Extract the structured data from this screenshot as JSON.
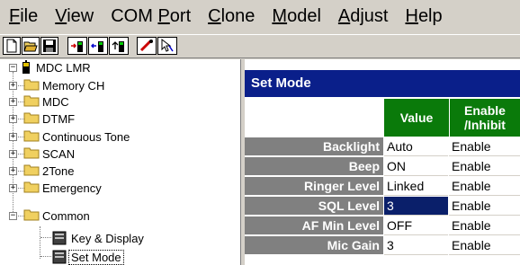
{
  "menubar": {
    "file": {
      "u": "F",
      "rest": "ile"
    },
    "view": {
      "u": "V",
      "rest": "iew"
    },
    "comport": {
      "pre": "COM ",
      "u": "P",
      "rest": "ort"
    },
    "clone": {
      "u": "C",
      "rest": "lone"
    },
    "model": {
      "u": "M",
      "rest": "odel"
    },
    "adjust": {
      "u": "A",
      "rest": "djust"
    },
    "help": {
      "u": "H",
      "rest": "elp"
    }
  },
  "toolbar": {
    "icons": [
      "new-icon",
      "open-icon",
      "save-icon",
      "read-from-radio-icon",
      "write-to-radio-icon",
      "radio-info-icon",
      "clone-icon",
      "help-pointer-icon"
    ]
  },
  "tree": {
    "root": "MDC LMR",
    "items": [
      "Memory CH",
      "MDC",
      "DTMF",
      "Continuous Tone",
      "SCAN",
      "2Tone",
      "Emergency",
      "Common"
    ],
    "common_children": [
      "Key & Display",
      "Set Mode"
    ]
  },
  "panel": {
    "title": "Set Mode",
    "header_value": "Value",
    "header_enable_1": "Enable",
    "header_enable_2": "/Inhibit"
  },
  "rows": [
    {
      "label": "Backlight",
      "value": "Auto",
      "enable": "Enable"
    },
    {
      "label": "Beep",
      "value": "ON",
      "enable": "Enable"
    },
    {
      "label": "Ringer Level",
      "value": "Linked",
      "enable": "Enable"
    },
    {
      "label": "SQL Level",
      "value": "3",
      "enable": "Enable"
    },
    {
      "label": "AF Min Level",
      "value": "OFF",
      "enable": "Enable"
    },
    {
      "label": "Mic Gain",
      "value": "3",
      "enable": "Enable"
    }
  ],
  "colors": {
    "title_bar": "#0a1f8a",
    "header_green": "#0a7a0a",
    "label_gray": "#808080",
    "selected_cell": "#0a1f6a"
  }
}
